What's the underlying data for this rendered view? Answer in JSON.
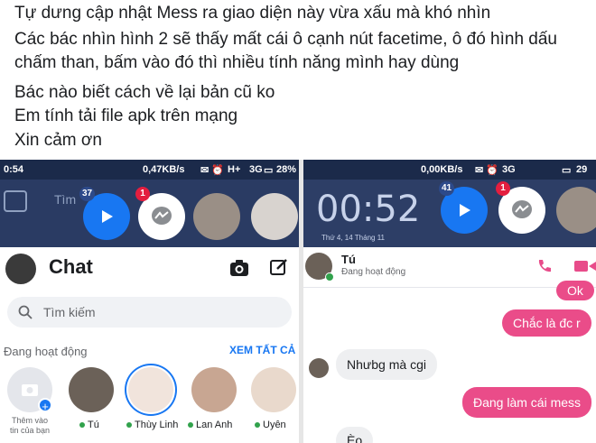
{
  "post": {
    "lines": [
      "Tự dưng cập nhật Mess ra giao diện này vừa xấu mà khó nhìn",
      "Các bác nhìn hình 2 sẽ thấy mất cái ô cạnh nút facetime, ô đó hình dấu",
      "chấm than, bấm vào đó thì nhiều tính năng mình hay dùng",
      "Bác nào biết cách về lại bản cũ ko",
      "Em tính tải file apk trên mạng",
      "Xin cảm ơn"
    ]
  },
  "left": {
    "status": {
      "time": "0:54",
      "net": "0,47KB/s",
      "signal": "H+",
      "net2": "3G",
      "battery": "28%"
    },
    "blur_search": "Tìm",
    "bubbles": {
      "video_badge": "37",
      "messenger_badge": "1"
    },
    "header": {
      "title": "Chat"
    },
    "search": {
      "placeholder": "Tìm kiếm"
    },
    "active": {
      "label": "Đang hoạt động",
      "see_all": "XEM TẤT CẢ"
    },
    "add_story": {
      "line1": "Thêm vào",
      "line2": "tin của bạn"
    },
    "contacts": [
      "Tú",
      "Thùy Linh",
      "Lan Anh",
      "Uyên"
    ]
  },
  "right": {
    "status": {
      "net": "0,00KB/s",
      "net2": "3G",
      "battery": "29"
    },
    "clock": "00:52",
    "date": "Thứ 4, 14 Tháng 11",
    "bubbles": {
      "video_badge": "41",
      "messenger_badge": "1"
    },
    "contact": {
      "name": "Tú",
      "status": "Đang hoạt động"
    },
    "messages": [
      {
        "dir": "out",
        "text": "Ok"
      },
      {
        "dir": "out",
        "text": "Chắc là đc r"
      },
      {
        "dir": "in",
        "text": "Nhưbg mà cgi"
      },
      {
        "dir": "out",
        "text": "Đang làm cái mess"
      },
      {
        "dir": "in",
        "text": "Èo"
      }
    ]
  },
  "colors": {
    "accent": "#1877f2",
    "bubble_out": "#ea4c89",
    "bubble_in": "#eeeff1",
    "status_bar": "#1b2a4a",
    "call_icons": "#e84c8a",
    "online": "#31a24c"
  }
}
